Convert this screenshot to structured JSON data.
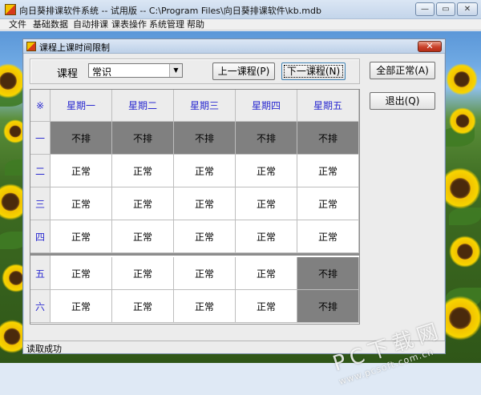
{
  "window": {
    "title": "向日葵排课软件系统 -- 试用版  -- C:\\Program Files\\向日葵排课软件\\kb.mdb",
    "min_label": "—",
    "max_label": "▭",
    "close_label": "✕"
  },
  "menu": [
    "文件",
    "基础数据",
    "自动排课",
    "课表操作",
    "系统管理",
    "帮助"
  ],
  "dialog": {
    "title": "课程上课时间限制",
    "close_label": "✕",
    "course_label": "课程",
    "course_value": "常识",
    "prev_button": "上一课程(P)",
    "next_button": "下一课程(N)",
    "all_normal_button": "全部正常(A)",
    "exit_button": "退出(Q)",
    "status": "读取成功"
  },
  "grid": {
    "corner": "※",
    "days": [
      "星期一",
      "星期二",
      "星期三",
      "星期四",
      "星期五"
    ],
    "periods": [
      "一",
      "二",
      "三",
      "四",
      "五",
      "六"
    ],
    "rows": [
      [
        "不排",
        "不排",
        "不排",
        "不排",
        "不排"
      ],
      [
        "正常",
        "正常",
        "正常",
        "正常",
        "正常"
      ],
      [
        "正常",
        "正常",
        "正常",
        "正常",
        "正常"
      ],
      [
        "正常",
        "正常",
        "正常",
        "正常",
        "正常"
      ],
      [
        "正常",
        "正常",
        "正常",
        "正常",
        "不排"
      ],
      [
        "正常",
        "正常",
        "正常",
        "正常",
        "不排"
      ]
    ]
  },
  "watermark": {
    "main": "PC下载网",
    "url": "www.pcsoft.com.cn"
  },
  "colors": {
    "blocked": "#808080",
    "normal": "#ffffff",
    "header_text": "#2a2ad0"
  }
}
